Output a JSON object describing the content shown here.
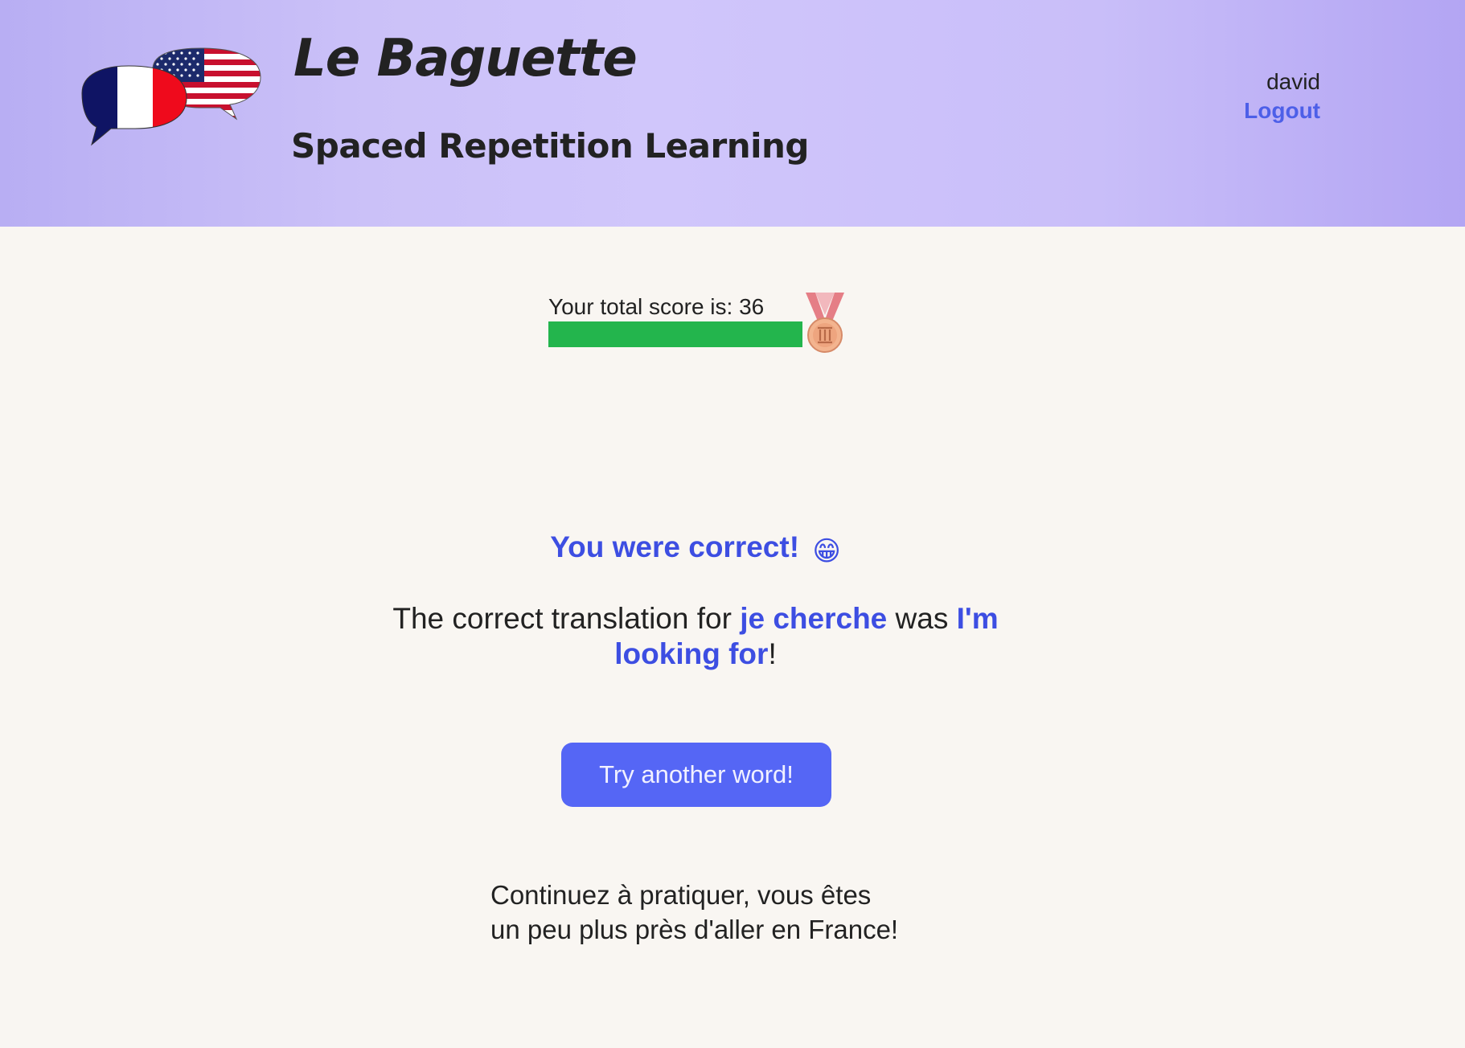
{
  "header": {
    "app_title": "Le Baguette",
    "subtitle": "Spaced Repetition Learning",
    "logo_icon": "french-american-speech-bubbles-logo",
    "user": {
      "username": "david",
      "logout_label": "Logout"
    },
    "colors": {
      "gradient_start": "#b8aef3",
      "gradient_end": "#b3a5f3"
    }
  },
  "score": {
    "label": "Your total score is: 36",
    "value": 36,
    "progress_fraction": 1.0,
    "bar_color": "#23b54d",
    "medal_icon": "third-place-medal-icon"
  },
  "feedback": {
    "heading": "You were correct!",
    "heading_emoji": "😁",
    "translation_prefix": "The correct translation for",
    "french_word": "je cherche",
    "translation_middle": "was",
    "english_word": "I'm looking for",
    "translation_suffix": "!",
    "accent_color": "#3d4ee2"
  },
  "actions": {
    "try_another_label": "Try another word!",
    "button_color": "#5566f5"
  },
  "encouragement": {
    "line1": "Continuez à pratiquer, vous êtes",
    "line2": "un peu plus près d'aller en France!"
  }
}
